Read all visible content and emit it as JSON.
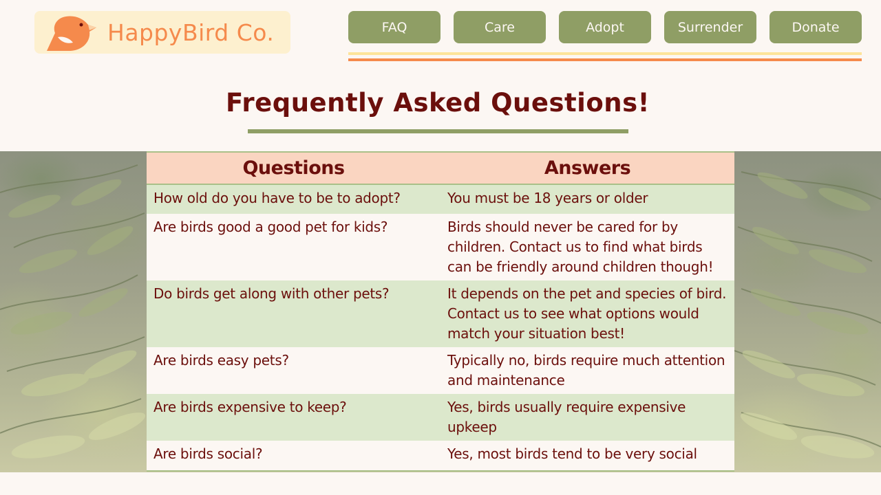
{
  "logo": {
    "text": "HappyBird Co."
  },
  "nav": {
    "items": [
      {
        "label": "FAQ"
      },
      {
        "label": "Care"
      },
      {
        "label": "Adopt"
      },
      {
        "label": "Surrender"
      },
      {
        "label": "Donate"
      }
    ]
  },
  "page": {
    "title": "Frequently Asked Questions!"
  },
  "faq": {
    "headers": {
      "question": "Questions",
      "answer": "Answers"
    },
    "rows": [
      {
        "question": "How old do you have to be to adopt?",
        "answer": "You must be 18 years or older"
      },
      {
        "question": "Are birds good a good pet for kids?",
        "answer": "Birds should never be cared for by children. Contact us to find what birds can be friendly around children though!"
      },
      {
        "question": "Do birds get along with other pets?",
        "answer": "It depends on the pet and species of bird. Contact us to see what options would match your situation best!"
      },
      {
        "question": "Are birds easy pets?",
        "answer": "Typically no, birds require much attention and maintenance"
      },
      {
        "question": "Are birds expensive to keep?",
        "answer": "Yes, birds usually require expensive upkeep"
      },
      {
        "question": "Are birds social?",
        "answer": "Yes, most birds tend to be very social"
      }
    ]
  },
  "colors": {
    "background": "#fcf7f3",
    "nav_button": "#8f9e65",
    "brand_orange": "#f58a4c",
    "text_maroon": "#6b0f0c",
    "row_green": "#dce8cc",
    "header_peach": "#fad5c1"
  },
  "icons": {
    "logo": "bird-icon"
  }
}
